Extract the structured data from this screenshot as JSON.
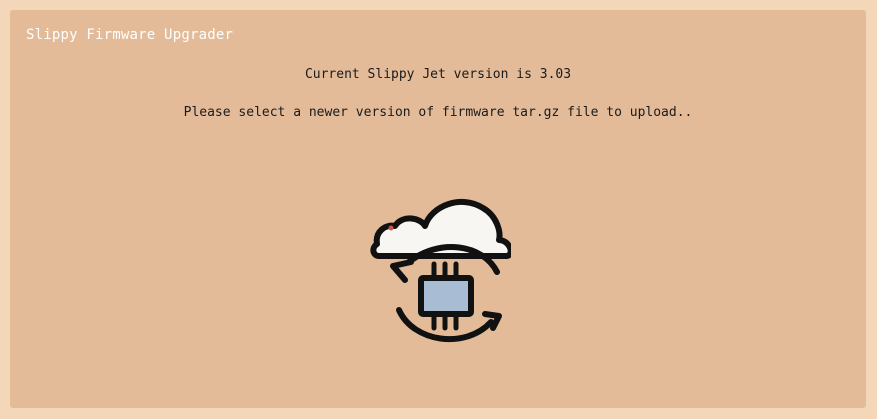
{
  "app": {
    "title": "Slippy Firmware Upgrader"
  },
  "main": {
    "version_text": "Current Slippy Jet version is 3.03",
    "prompt_text": "Please select a newer version of firmware tar.gz file to upload.."
  },
  "icons": {
    "upload": "cloud-firmware-sync-icon"
  },
  "colors": {
    "page_bg": "#f4d7b9",
    "panel_bg": "#e3bb99",
    "cloud_fill": "#f8f6f3",
    "chip_fill": "#a8bdd3",
    "stroke": "#111111"
  }
}
